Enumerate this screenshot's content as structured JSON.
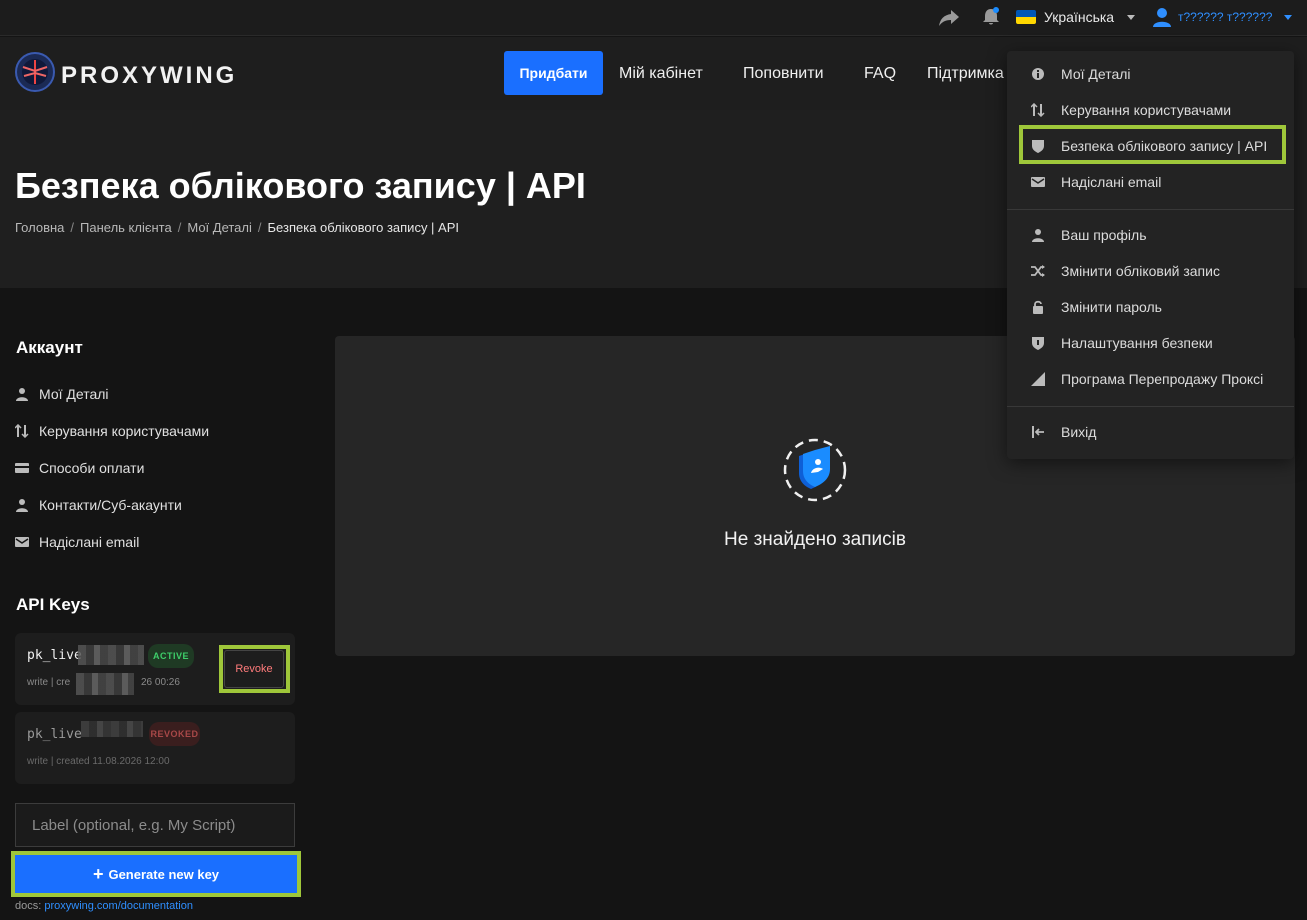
{
  "topbar": {
    "language": "Українська",
    "user_name": "т?????? т??????",
    "flag_colors": [
      "#0057b7",
      "#ffd700"
    ]
  },
  "nav": {
    "brand": "PROXYWING",
    "buy_label": "Придбати",
    "links": [
      "Мій кабінет",
      "Поповнити",
      "FAQ",
      "Підтримка"
    ]
  },
  "hero": {
    "title": "Безпека облікового запису | API",
    "breadcrumbs": [
      "Головна",
      "Панель клієнта",
      "Мої Деталі",
      "Безпека облікового запису | API"
    ]
  },
  "sidebar": {
    "account_heading": "Аккаунт",
    "items": [
      {
        "label": "Мої Деталі",
        "icon": "user-icon"
      },
      {
        "label": "Керування користувачами",
        "icon": "sliders-icon"
      },
      {
        "label": "Способи оплати",
        "icon": "card-icon"
      },
      {
        "label": "Контакти/Суб-акаунти",
        "icon": "user-icon"
      },
      {
        "label": "Надіслані email",
        "icon": "mail-icon"
      }
    ],
    "api_heading": "API Keys"
  },
  "api_keys": [
    {
      "prefix": "pk_live",
      "status": "ACTIVE",
      "meta_start": "write | cre",
      "meta_end": "26 00:26"
    },
    {
      "prefix": "pk_live",
      "status": "REVOKED",
      "meta": "write | created 11.08.2026 12:00"
    }
  ],
  "revoke_label": "Revoke",
  "label_input": {
    "placeholder": "Label (optional, e.g. My Script)",
    "value": ""
  },
  "generate_label": "Generate new key",
  "docs": {
    "prefix": "docs:",
    "link": "proxywing.com/documentation"
  },
  "main": {
    "empty_text": "Не знайдено записів"
  },
  "dropdown": {
    "group1": [
      {
        "label": "Мої Деталі",
        "icon": "info-icon"
      },
      {
        "label": "Керування користувачами",
        "icon": "sliders-icon"
      },
      {
        "label": "Безпека облікового запису | API",
        "icon": "shield-icon"
      },
      {
        "label": "Надіслані email",
        "icon": "mail-icon"
      }
    ],
    "group2": [
      {
        "label": "Ваш профіль",
        "icon": "user-icon"
      },
      {
        "label": "Змінити обліковий запис",
        "icon": "shuffle-icon"
      },
      {
        "label": "Змінити пароль",
        "icon": "lock-icon"
      },
      {
        "label": "Налаштування безпеки",
        "icon": "shield-icon"
      },
      {
        "label": "Програма Перепродажу Проксі",
        "icon": "signal-icon"
      }
    ],
    "group3": [
      {
        "label": "Вихід",
        "icon": "logout-icon"
      }
    ]
  },
  "colors": {
    "accent": "#1a6fff",
    "highlight": "#9fc73a",
    "active": "#3ecf6a",
    "revoked": "#a84848"
  }
}
